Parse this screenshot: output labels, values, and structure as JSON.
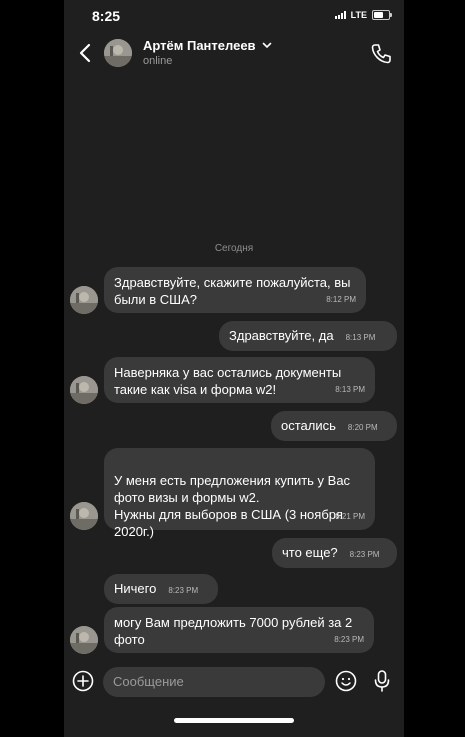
{
  "status_bar": {
    "time": "8:25",
    "network": "LTE"
  },
  "header": {
    "name": "Артём Пантелеев",
    "status": "online"
  },
  "day_separator": "Сегодня",
  "messages": [
    {
      "from": "them",
      "text": "Здравствуйте, скажите пожалуйста, вы были в США?",
      "time": "8:12 PM"
    },
    {
      "from": "me",
      "text": "Здравствуйте, да",
      "time": "8:13 PM"
    },
    {
      "from": "them",
      "text": "Наверняка у вас остались документы такие как visa и форма w2!",
      "time": "8:13 PM"
    },
    {
      "from": "me",
      "text": "остались",
      "time": "8:20 PM"
    },
    {
      "from": "them",
      "text": "У меня есть предложения купить у Вас фото визы и формы w2.\nНужны для выборов в США (3 ноября 2020г.)",
      "time": "8:21 PM"
    },
    {
      "from": "me",
      "text": "что еще?",
      "time": "8:23 PM"
    },
    {
      "from": "them",
      "text": "Ничего",
      "time": "8:23 PM"
    },
    {
      "from": "them",
      "text": "могу Вам предложить 7000 рублей за 2 фото",
      "time": "8:23 PM"
    }
  ],
  "composer": {
    "placeholder": "Сообщение"
  },
  "colors": {
    "background": "#1f1f1f",
    "bubble": "#3a3a3a",
    "text": "#ffffff",
    "muted": "#9a9a9a"
  },
  "icons": [
    "back-arrow-icon",
    "chevron-down-icon",
    "phone-icon",
    "plus-icon",
    "emoji-icon",
    "microphone-icon"
  ]
}
